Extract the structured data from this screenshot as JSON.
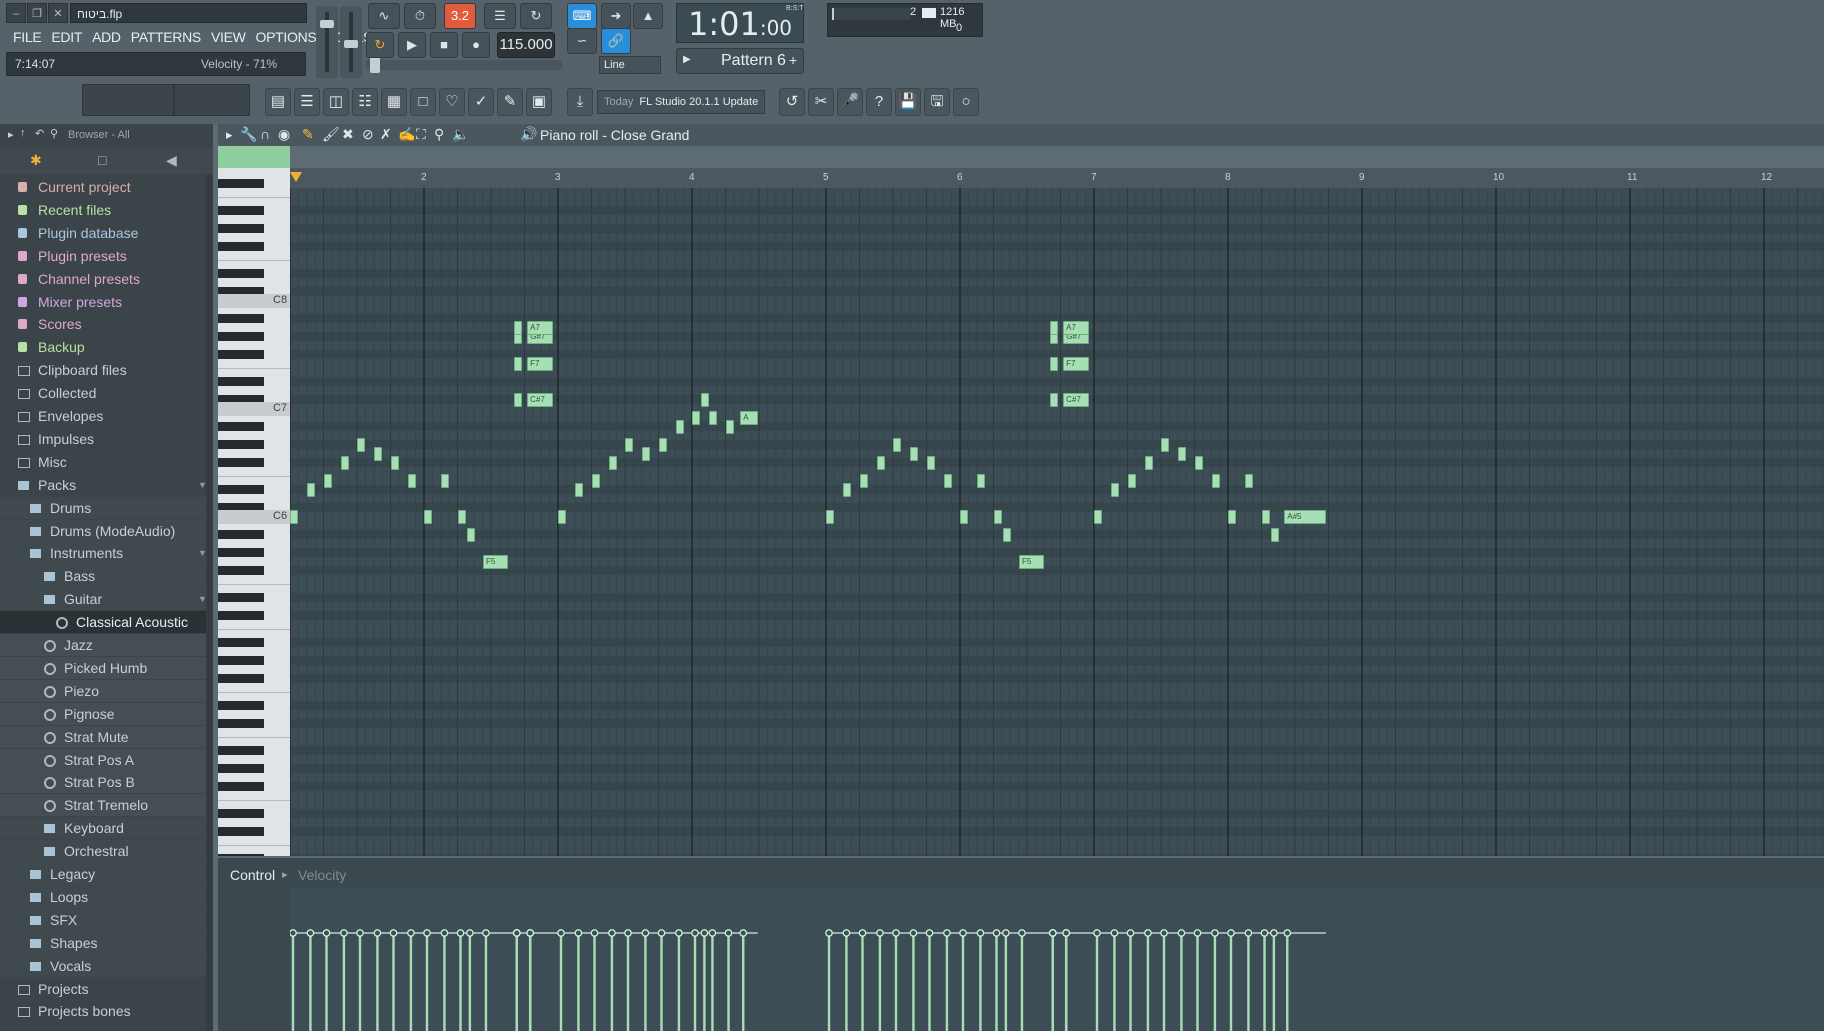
{
  "window": {
    "title": "ביטוח.flp"
  },
  "menu": [
    "FILE",
    "EDIT",
    "ADD",
    "PATTERNS",
    "VIEW",
    "OPTIONS",
    "TOOLS",
    "?"
  ],
  "hint": {
    "time": "7:14:07",
    "text": "Velocity - 71%"
  },
  "transport": {
    "tempo": "115.000",
    "time_main": "1:01",
    "time_sub": ":00",
    "bst_label": "B:S:T",
    "pattern": "Pattern 6",
    "snap": "Line",
    "pat_indicator": "3.2"
  },
  "cpu": {
    "polyphony": "2",
    "memory": "1216 MB",
    "cpu": "0"
  },
  "news": {
    "date": "Today",
    "title": "FL Studio 20.1.1 Update"
  },
  "browser": {
    "header": "Browser - All",
    "items": [
      {
        "label": "Current project",
        "level": 0,
        "icon": "project-icon",
        "color": "#d6b0a8"
      },
      {
        "label": "Recent files",
        "level": 0,
        "icon": "recent-icon",
        "color": "#b9e0a5"
      },
      {
        "label": "Plugin database",
        "level": 0,
        "icon": "plugin-db-icon",
        "color": "#a8c8e0"
      },
      {
        "label": "Plugin presets",
        "level": 0,
        "icon": "plugin-presets-icon",
        "color": "#e0a8d0"
      },
      {
        "label": "Channel presets",
        "level": 0,
        "icon": "channel-presets-icon",
        "color": "#e0a8c0"
      },
      {
        "label": "Mixer presets",
        "level": 0,
        "icon": "mixer-presets-icon",
        "color": "#d0a8e0"
      },
      {
        "label": "Scores",
        "level": 0,
        "icon": "scores-icon",
        "color": "#e0a8c8"
      },
      {
        "label": "Backup",
        "level": 0,
        "icon": "backup-icon",
        "color": "#b9e0a5"
      },
      {
        "label": "Clipboard files",
        "level": 0,
        "icon": "folder-icon",
        "color": "#c6d0d5"
      },
      {
        "label": "Collected",
        "level": 0,
        "icon": "folder-icon",
        "color": "#c6d0d5"
      },
      {
        "label": "Envelopes",
        "level": 0,
        "icon": "folder-icon",
        "color": "#c6d0d5"
      },
      {
        "label": "Impulses",
        "level": 0,
        "icon": "folder-icon",
        "color": "#c6d0d5"
      },
      {
        "label": "Misc",
        "level": 0,
        "icon": "folder-icon",
        "color": "#c6d0d5"
      },
      {
        "label": "Packs",
        "level": 0,
        "icon": "pack-folder-icon",
        "color": "#c6d0d5",
        "open": true
      },
      {
        "label": "Drums",
        "level": 1,
        "icon": "pack-folder-icon",
        "color": "#c6d0d5"
      },
      {
        "label": "Drums (ModeAudio)",
        "level": 1,
        "icon": "pack-folder-icon",
        "color": "#c6d0d5"
      },
      {
        "label": "Instruments",
        "level": 1,
        "icon": "pack-folder-icon",
        "color": "#c6d0d5",
        "open": true
      },
      {
        "label": "Bass",
        "level": 2,
        "icon": "pack-folder-icon",
        "color": "#c6d0d5"
      },
      {
        "label": "Guitar",
        "level": 2,
        "icon": "pack-folder-icon",
        "color": "#c6d0d5",
        "open": true
      },
      {
        "label": "Classical Acoustic",
        "level": 3,
        "icon": "preset-gear-icon",
        "color": "#e6edf0",
        "selected": true
      },
      {
        "label": "Jazz",
        "level": 3,
        "icon": "preset-gear-icon",
        "color": "#c6d0d5"
      },
      {
        "label": "Picked Humb",
        "level": 3,
        "icon": "preset-gear-icon",
        "color": "#c6d0d5"
      },
      {
        "label": "Piezo",
        "level": 3,
        "icon": "preset-gear-icon",
        "color": "#c6d0d5"
      },
      {
        "label": "Pignose",
        "level": 3,
        "icon": "preset-gear-icon",
        "color": "#c6d0d5"
      },
      {
        "label": "Strat Mute",
        "level": 3,
        "icon": "preset-gear-icon",
        "color": "#c6d0d5"
      },
      {
        "label": "Strat Pos A",
        "level": 3,
        "icon": "preset-gear-icon",
        "color": "#c6d0d5"
      },
      {
        "label": "Strat Pos B",
        "level": 3,
        "icon": "preset-gear-icon",
        "color": "#c6d0d5"
      },
      {
        "label": "Strat Tremelo",
        "level": 3,
        "icon": "preset-gear-icon",
        "color": "#c6d0d5"
      },
      {
        "label": "Keyboard",
        "level": 2,
        "icon": "pack-folder-icon",
        "color": "#c6d0d5"
      },
      {
        "label": "Orchestral",
        "level": 2,
        "icon": "pack-folder-icon",
        "color": "#c6d0d5"
      },
      {
        "label": "Legacy",
        "level": 1,
        "icon": "pack-folder-icon",
        "color": "#c6d0d5"
      },
      {
        "label": "Loops",
        "level": 1,
        "icon": "pack-folder-icon",
        "color": "#c6d0d5"
      },
      {
        "label": "SFX",
        "level": 1,
        "icon": "pack-folder-icon",
        "color": "#c6d0d5"
      },
      {
        "label": "Shapes",
        "level": 1,
        "icon": "pack-folder-icon",
        "color": "#c6d0d5"
      },
      {
        "label": "Vocals",
        "level": 1,
        "icon": "pack-folder-icon",
        "color": "#c6d0d5"
      },
      {
        "label": "Projects",
        "level": 0,
        "icon": "folder-icon",
        "color": "#c6d0d5"
      },
      {
        "label": "Projects bones",
        "level": 0,
        "icon": "folder-icon",
        "color": "#c6d0d5"
      }
    ]
  },
  "piano_roll": {
    "title": "Piano roll - Close Grand",
    "bars": [
      "2",
      "3",
      "4",
      "5",
      "6",
      "7",
      "8",
      "9",
      "10",
      "11",
      "12"
    ],
    "octave_labels": [
      "C8",
      "C7",
      "C6"
    ],
    "control_label": "Control",
    "control_target": "Velocity",
    "notes": [
      {
        "bar": 1.0,
        "key": 72,
        "len": 0.06,
        "label": ""
      },
      {
        "bar": 1.13,
        "key": 75,
        "len": 0.06,
        "label": ""
      },
      {
        "bar": 1.25,
        "key": 76,
        "len": 0.06,
        "label": ""
      },
      {
        "bar": 1.38,
        "key": 78,
        "len": 0.06,
        "label": ""
      },
      {
        "bar": 1.5,
        "key": 80,
        "len": 0.06,
        "label": ""
      },
      {
        "bar": 1.63,
        "key": 79,
        "len": 0.06,
        "label": ""
      },
      {
        "bar": 1.75,
        "key": 78,
        "len": 0.06,
        "label": ""
      },
      {
        "bar": 1.88,
        "key": 76,
        "len": 0.06,
        "label": ""
      },
      {
        "bar": 2.0,
        "key": 72,
        "len": 0.06,
        "label": ""
      },
      {
        "bar": 2.13,
        "key": 76,
        "len": 0.06,
        "label": ""
      },
      {
        "bar": 2.25,
        "key": 72,
        "len": 0.06,
        "label": ""
      },
      {
        "bar": 2.32,
        "key": 70,
        "len": 0.06,
        "label": ""
      },
      {
        "bar": 2.44,
        "key": 67,
        "len": 0.19,
        "label": "F5"
      },
      {
        "bar": 2.67,
        "key": 85,
        "len": 0.06,
        "label": ""
      },
      {
        "bar": 2.67,
        "key": 89,
        "len": 0.06,
        "label": ""
      },
      {
        "bar": 2.67,
        "key": 92,
        "len": 0.06,
        "label": ""
      },
      {
        "bar": 2.67,
        "key": 93,
        "len": 0.06,
        "label": ""
      },
      {
        "bar": 2.77,
        "key": 85,
        "len": 0.19,
        "label": "C#7"
      },
      {
        "bar": 2.77,
        "key": 89,
        "len": 0.19,
        "label": "F7"
      },
      {
        "bar": 2.77,
        "key": 92,
        "len": 0.19,
        "label": "G#7"
      },
      {
        "bar": 2.77,
        "key": 93,
        "len": 0.19,
        "label": "A7"
      },
      {
        "bar": 3.0,
        "key": 72,
        "len": 0.06,
        "label": ""
      },
      {
        "bar": 3.13,
        "key": 75,
        "len": 0.06,
        "label": ""
      },
      {
        "bar": 3.25,
        "key": 76,
        "len": 0.06,
        "label": ""
      },
      {
        "bar": 3.38,
        "key": 78,
        "len": 0.06,
        "label": ""
      },
      {
        "bar": 3.5,
        "key": 80,
        "len": 0.06,
        "label": ""
      },
      {
        "bar": 3.63,
        "key": 79,
        "len": 0.06,
        "label": ""
      },
      {
        "bar": 3.75,
        "key": 80,
        "len": 0.06,
        "label": ""
      },
      {
        "bar": 3.88,
        "key": 82,
        "len": 0.06,
        "label": ""
      },
      {
        "bar": 4.0,
        "key": 83,
        "len": 0.06,
        "label": ""
      },
      {
        "bar": 4.07,
        "key": 85,
        "len": 0.06,
        "label": ""
      },
      {
        "bar": 4.13,
        "key": 83,
        "len": 0.06,
        "label": ""
      },
      {
        "bar": 4.25,
        "key": 82,
        "len": 0.06,
        "label": ""
      },
      {
        "bar": 4.36,
        "key": 83,
        "len": 0.13,
        "label": "A"
      },
      {
        "bar": 5.0,
        "key": 72,
        "len": 0.06,
        "label": ""
      },
      {
        "bar": 5.13,
        "key": 75,
        "len": 0.06,
        "label": ""
      },
      {
        "bar": 5.25,
        "key": 76,
        "len": 0.06,
        "label": ""
      },
      {
        "bar": 5.38,
        "key": 78,
        "len": 0.06,
        "label": ""
      },
      {
        "bar": 5.5,
        "key": 80,
        "len": 0.06,
        "label": ""
      },
      {
        "bar": 5.63,
        "key": 79,
        "len": 0.06,
        "label": ""
      },
      {
        "bar": 5.75,
        "key": 78,
        "len": 0.06,
        "label": ""
      },
      {
        "bar": 5.88,
        "key": 76,
        "len": 0.06,
        "label": ""
      },
      {
        "bar": 6.0,
        "key": 72,
        "len": 0.06,
        "label": ""
      },
      {
        "bar": 6.13,
        "key": 76,
        "len": 0.06,
        "label": ""
      },
      {
        "bar": 6.25,
        "key": 72,
        "len": 0.06,
        "label": ""
      },
      {
        "bar": 6.32,
        "key": 70,
        "len": 0.06,
        "label": ""
      },
      {
        "bar": 6.44,
        "key": 67,
        "len": 0.19,
        "label": "F5"
      },
      {
        "bar": 6.67,
        "key": 85,
        "len": 0.06,
        "label": ""
      },
      {
        "bar": 6.67,
        "key": 89,
        "len": 0.06,
        "label": ""
      },
      {
        "bar": 6.67,
        "key": 92,
        "len": 0.06,
        "label": ""
      },
      {
        "bar": 6.67,
        "key": 93,
        "len": 0.06,
        "label": ""
      },
      {
        "bar": 6.77,
        "key": 85,
        "len": 0.19,
        "label": "C#7"
      },
      {
        "bar": 6.77,
        "key": 89,
        "len": 0.19,
        "label": "F7"
      },
      {
        "bar": 6.77,
        "key": 92,
        "len": 0.19,
        "label": "G#7"
      },
      {
        "bar": 6.77,
        "key": 93,
        "len": 0.19,
        "label": "A7"
      },
      {
        "bar": 7.0,
        "key": 72,
        "len": 0.06,
        "label": ""
      },
      {
        "bar": 7.13,
        "key": 75,
        "len": 0.06,
        "label": ""
      },
      {
        "bar": 7.25,
        "key": 76,
        "len": 0.06,
        "label": ""
      },
      {
        "bar": 7.38,
        "key": 78,
        "len": 0.06,
        "label": ""
      },
      {
        "bar": 7.5,
        "key": 80,
        "len": 0.06,
        "label": ""
      },
      {
        "bar": 7.63,
        "key": 79,
        "len": 0.06,
        "label": ""
      },
      {
        "bar": 7.75,
        "key": 78,
        "len": 0.06,
        "label": ""
      },
      {
        "bar": 7.88,
        "key": 76,
        "len": 0.06,
        "label": ""
      },
      {
        "bar": 8.0,
        "key": 72,
        "len": 0.06,
        "label": ""
      },
      {
        "bar": 8.13,
        "key": 76,
        "len": 0.06,
        "label": ""
      },
      {
        "bar": 8.25,
        "key": 72,
        "len": 0.06,
        "label": ""
      },
      {
        "bar": 8.32,
        "key": 70,
        "len": 0.06,
        "label": ""
      },
      {
        "bar": 8.42,
        "key": 72,
        "len": 0.31,
        "label": "A#5"
      }
    ]
  }
}
